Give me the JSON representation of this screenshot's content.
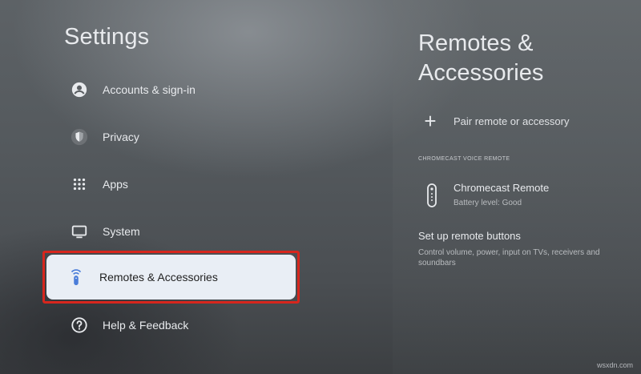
{
  "settings": {
    "title": "Settings",
    "menu": [
      {
        "label": "Accounts & sign-in",
        "icon": "account-icon"
      },
      {
        "label": "Privacy",
        "icon": "shield-icon"
      },
      {
        "label": "Apps",
        "icon": "apps-grid-icon"
      },
      {
        "label": "System",
        "icon": "tv-icon"
      },
      {
        "label": "Remotes & Accessories",
        "icon": "remote-icon",
        "selected": true
      },
      {
        "label": "Help & Feedback",
        "icon": "help-icon"
      }
    ]
  },
  "panel": {
    "title": "Remotes & Accessories",
    "pair_label": "Pair remote or accessory",
    "section_header": "CHROMECAST VOICE REMOTE",
    "device": {
      "name": "Chromecast Remote",
      "status": "Battery level: Good",
      "icon": "remote-icon"
    },
    "setup": {
      "title": "Set up remote buttons",
      "description": "Control volume, power, input on TVs, receivers and soundbars"
    }
  },
  "watermark": "wsxdn.com",
  "colors": {
    "highlight_border": "#d7261d",
    "selected_card": "#e9eef5",
    "accent_icon": "#4a7dd9"
  }
}
